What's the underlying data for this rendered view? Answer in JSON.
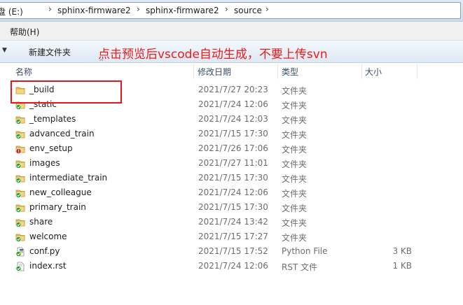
{
  "address": {
    "crumbs": [
      "盘 (E:)",
      "sphinx-firmware2",
      "sphinx-firmware2",
      "source"
    ]
  },
  "menu": {
    "help_label": "帮助(H)"
  },
  "toolbar": {
    "new_folder_label": "新建文件夹"
  },
  "annotation": {
    "text": "点击预览后vscode自动生成，不要上传svn",
    "color": "#ee1a1a"
  },
  "columns": {
    "name": "名称",
    "date": "修改日期",
    "type": "类型",
    "size": "大小"
  },
  "files": [
    {
      "name": "_build",
      "date": "2021/7/27 20:23",
      "type": "文件夹",
      "size": "",
      "icon": "folder-icon"
    },
    {
      "name": "_static",
      "date": "2021/7/24 12:06",
      "type": "文件夹",
      "size": "",
      "icon": "svn-ok-folder-icon"
    },
    {
      "name": "_templates",
      "date": "2021/7/24 12:03",
      "type": "文件夹",
      "size": "",
      "icon": "svn-ok-folder-icon"
    },
    {
      "name": "advanced_train",
      "date": "2021/7/15 17:30",
      "type": "文件夹",
      "size": "",
      "icon": "svn-ok-folder-icon"
    },
    {
      "name": "env_setup",
      "date": "2021/7/26 17:06",
      "type": "文件夹",
      "size": "",
      "icon": "svn-modified-folder-icon"
    },
    {
      "name": "images",
      "date": "2021/7/27 11:01",
      "type": "文件夹",
      "size": "",
      "icon": "svn-ok-folder-icon"
    },
    {
      "name": "intermediate_train",
      "date": "2021/7/15 17:30",
      "type": "文件夹",
      "size": "",
      "icon": "svn-ok-folder-icon"
    },
    {
      "name": "new_colleague",
      "date": "2021/7/24 12:06",
      "type": "文件夹",
      "size": "",
      "icon": "svn-ok-folder-icon"
    },
    {
      "name": "primary_train",
      "date": "2021/7/15 17:30",
      "type": "文件夹",
      "size": "",
      "icon": "svn-ok-folder-icon"
    },
    {
      "name": "share",
      "date": "2021/7/24 13:42",
      "type": "文件夹",
      "size": "",
      "icon": "svn-ok-folder-icon"
    },
    {
      "name": "welcome",
      "date": "2021/7/15 17:27",
      "type": "文件夹",
      "size": "",
      "icon": "svn-ok-folder-icon"
    },
    {
      "name": "conf.py",
      "date": "2021/7/15 17:52",
      "type": "Python File",
      "size": "3 KB",
      "icon": "svn-ok-python-file-icon"
    },
    {
      "name": "index.rst",
      "date": "2021/7/24 12:06",
      "type": "RST 文件",
      "size": "1 KB",
      "icon": "svn-ok-file-icon"
    }
  ]
}
